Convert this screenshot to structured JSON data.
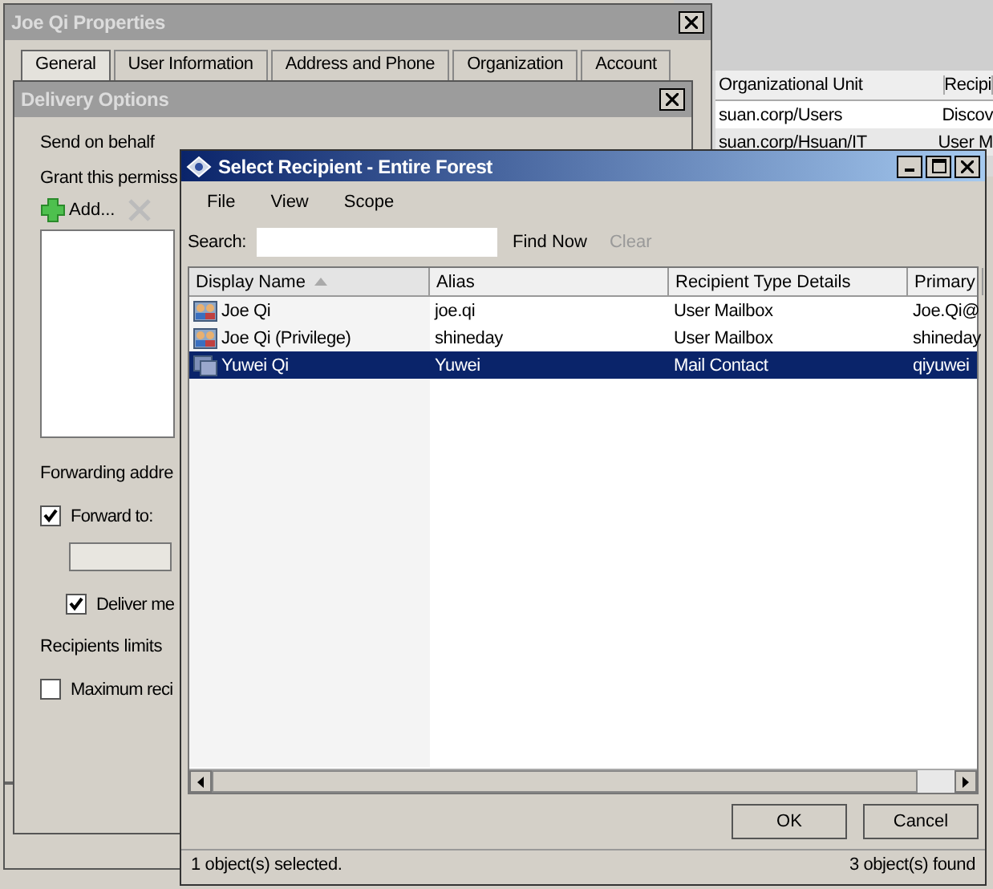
{
  "background_window": {
    "columns": [
      "Organizational Unit",
      "Recipi"
    ],
    "rows": [
      [
        "suan.corp/Users",
        "Discov"
      ],
      [
        "suan.corp/Hsuan/IT",
        "User M"
      ]
    ]
  },
  "properties_window": {
    "title": "Joe Qi Properties",
    "tabs": [
      {
        "label": "General",
        "selected": true
      },
      {
        "label": "User Information",
        "selected": false
      },
      {
        "label": "Address and Phone",
        "selected": false
      },
      {
        "label": "Organization",
        "selected": false
      },
      {
        "label": "Account",
        "selected": false
      }
    ]
  },
  "delivery_options": {
    "title": "Delivery Options",
    "send_on_behalf": "Send on behalf",
    "grant_text": "Grant this permiss",
    "add_button": "Add...",
    "forwarding_label": "Forwarding addre",
    "checkboxes": [
      {
        "label": "Forward to:",
        "checked": true,
        "indent": false
      },
      {
        "label": "Deliver me",
        "checked": true,
        "indent": true
      },
      {
        "label": "Maximum reci",
        "checked": false,
        "indent": false
      }
    ],
    "limits_label": "Recipients limits"
  },
  "select_recipient": {
    "title": "Select Recipient - Entire Forest",
    "menu": [
      "File",
      "View",
      "Scope"
    ],
    "search": {
      "label": "Search:",
      "find_now": {
        "label": "Find Now",
        "disabled": false
      },
      "clear": {
        "label": "Clear",
        "disabled": true
      }
    },
    "columns": [
      {
        "label": "Display Name",
        "sorted": true
      },
      {
        "label": "Alias",
        "sorted": false
      },
      {
        "label": "Recipient Type Details",
        "sorted": false
      },
      {
        "label": "Primary",
        "sorted": false
      }
    ],
    "rows": [
      {
        "kind": "mailbox",
        "selected": false,
        "cells": [
          "Joe Qi",
          "joe.qi",
          "User Mailbox",
          "Joe.Qi@"
        ]
      },
      {
        "kind": "mailbox",
        "selected": false,
        "cells": [
          "Joe Qi (Privilege)",
          "shineday",
          "User Mailbox",
          "shineday"
        ]
      },
      {
        "kind": "contact",
        "selected": true,
        "cells": [
          "Yuwei Qi",
          "Yuwei",
          "Mail Contact",
          "qiyuwei"
        ]
      }
    ],
    "buttons": [
      "OK",
      "Cancel"
    ],
    "status_left": "1 object(s) selected.",
    "status_right": "3 object(s) found"
  }
}
